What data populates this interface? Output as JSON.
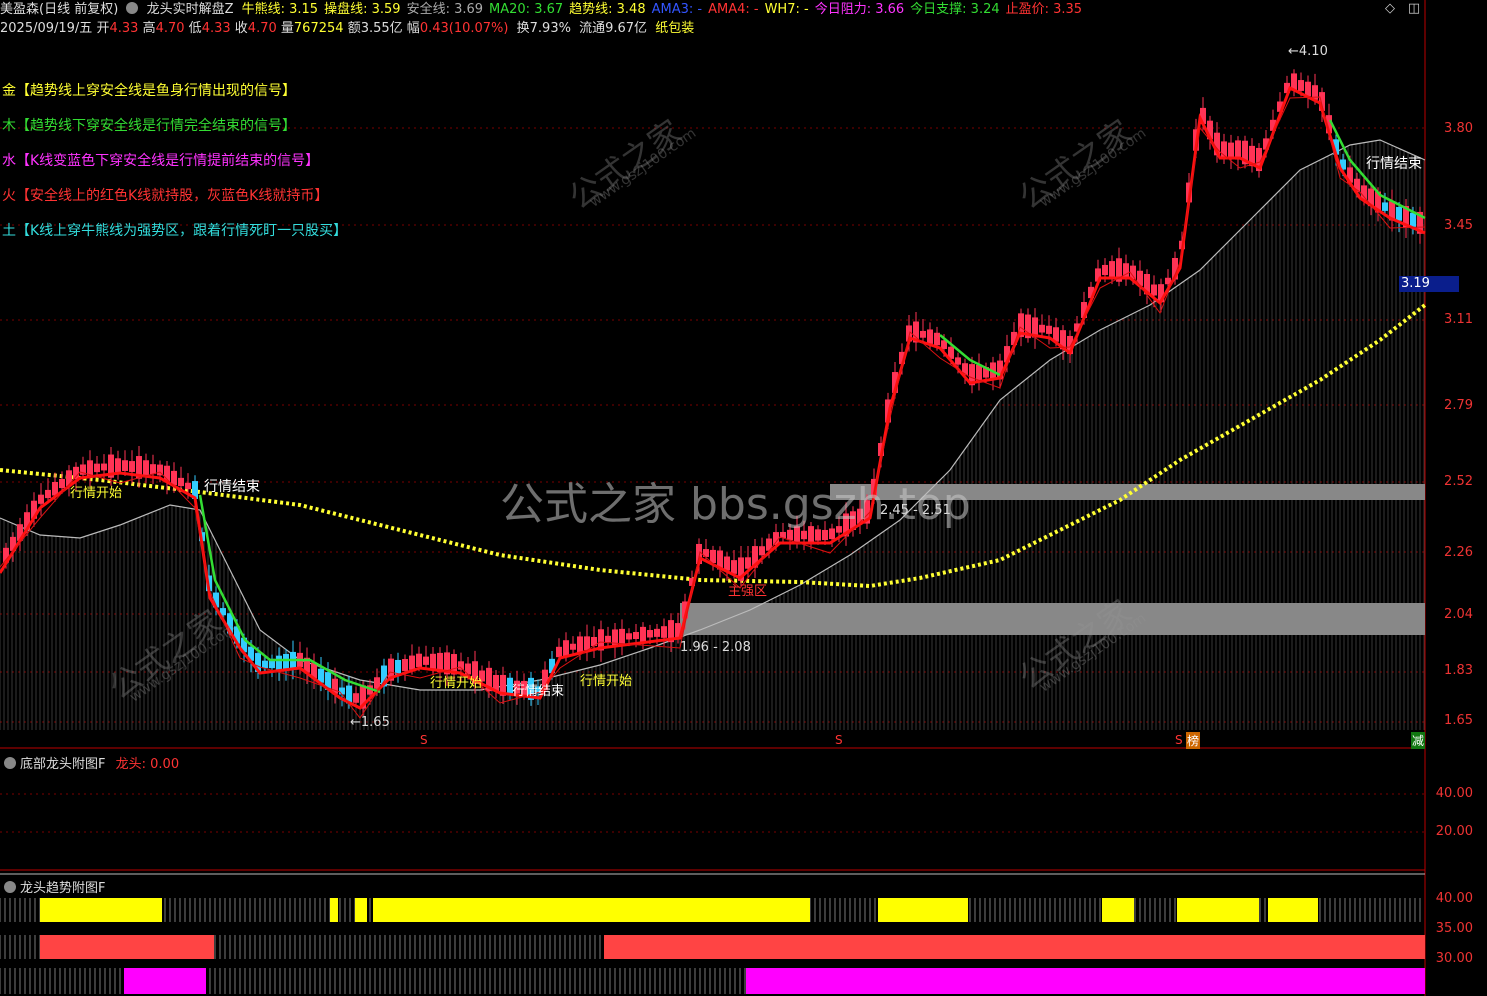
{
  "header": {
    "stock_name": "美盈森(日线 前复权)",
    "indicator_name": "龙头实时解盘",
    "indicator_suffix": "Z",
    "values": [
      {
        "label": "牛熊线:",
        "value": "3.15",
        "color": "#ffff33"
      },
      {
        "label": "操盘线:",
        "value": "3.59",
        "color": "#ffff33"
      },
      {
        "label": "安全线:",
        "value": "3.69",
        "color": "#aaaaaa"
      },
      {
        "label": "MA20:",
        "value": "3.67",
        "color": "#33dd33"
      },
      {
        "label": "趋势线:",
        "value": "3.48",
        "color": "#ffff33"
      },
      {
        "label": "AMA3:",
        "value": "-",
        "color": "#3355ff"
      },
      {
        "label": "AMA4:",
        "value": "-",
        "color": "#ff3333"
      },
      {
        "label": "WH7:",
        "value": "-",
        "color": "#ffff33"
      },
      {
        "label": "今日阻力:",
        "value": "3.66",
        "color": "#ff33ff"
      },
      {
        "label": "今日支撑:",
        "value": "3.24",
        "color": "#33dd33"
      },
      {
        "label": "止盈价:",
        "value": "3.35",
        "color": "#ff3333"
      }
    ],
    "quote": {
      "date": "2025/09/19/五",
      "open_label": "开",
      "open": "4.33",
      "high_label": "高",
      "high": "4.70",
      "low_label": "低",
      "low": "4.33",
      "close_label": "收",
      "close": "4.70",
      "volume_label": "量",
      "volume": "767254",
      "amount_label": "额",
      "amount": "3.55亿",
      "change_label": "幅",
      "change": "0.43(10.07%)",
      "turnover_label": "换",
      "turnover": "7.93%",
      "float_label": "流通",
      "float": "9.67亿",
      "sector": "纸包装"
    }
  },
  "legend": [
    {
      "text": "金【趋势线上穿安全线是鱼身行情出现的信号】",
      "color": "#ffff33"
    },
    {
      "text": "木【趋势线下穿安全线是行情完全结束的信号】",
      "color": "#33dd33"
    },
    {
      "text": "水【K线变蓝色下穿安全线是行情提前结束的信号】",
      "color": "#ff33ff"
    },
    {
      "text": "火【安全线上的红色K线就持股，灰蓝色K线就持币】",
      "color": "#ff3333"
    },
    {
      "text": "土【K线上穿牛熊线为强势区，跟着行情死盯一只股买】",
      "color": "#33dddd"
    }
  ],
  "annotations": {
    "high_marker": "←4.10",
    "low_marker": "←1.65",
    "market_end_1": "行情结束",
    "market_start_1": "行情开始",
    "market_start_2": "行情开始",
    "market_end_2": "行情结束",
    "market_start_3": "行情开始",
    "market_end_3": "行情结束",
    "strong_zone": "主强区",
    "band_upper": "2.45 - 2.51",
    "band_lower": "1.96 - 2.08",
    "watermark_center": "公式之家 bbs.gszh.top",
    "watermark_small": "公式之家",
    "watermark_url": "www.gszj100.com",
    "s_marker": "S",
    "bang_marker": "榜",
    "jian_marker": "减"
  },
  "price_axis": {
    "ticks": [
      "3.80",
      "3.45",
      "3.11",
      "2.79",
      "2.52",
      "2.26",
      "2.04",
      "1.83",
      "1.65"
    ],
    "current_price": "3.19"
  },
  "sub_panel_1": {
    "title": "底部龙头附图F",
    "value_label": "龙头:",
    "value": "0.00",
    "ticks": [
      "40.00",
      "20.00"
    ]
  },
  "sub_panel_2": {
    "title": "龙头趋势附图F",
    "ticks": [
      "40.00",
      "35.00",
      "30.00"
    ]
  },
  "colors": {
    "up_candle": "#ff3355",
    "down_candle": "#33ccff",
    "trend_red": "#ff1111",
    "trend_green": "#33dd33",
    "bull_bear_line": "#ffff33",
    "grid": "#7a0000",
    "band": "#888888",
    "bar_yellow": "#ffff00",
    "bar_red": "#ff4444",
    "bar_magenta": "#ff00ff"
  }
}
